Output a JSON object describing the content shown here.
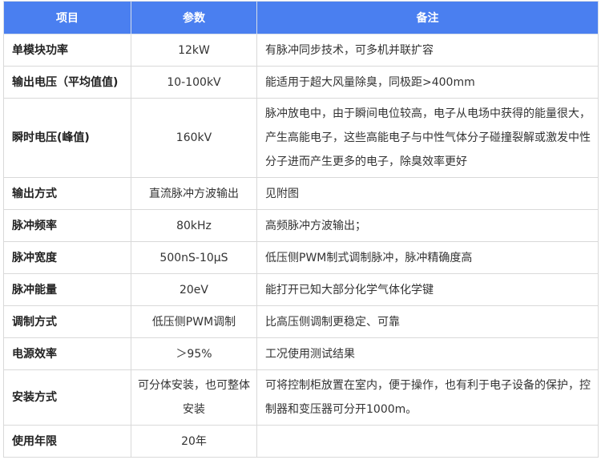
{
  "header": {
    "col1": "项目",
    "col2": "参数",
    "col3": "备注"
  },
  "rows": [
    {
      "item": "单模块功率",
      "param": "12kW",
      "note": "有脉冲同步技术，可多机并联扩容"
    },
    {
      "item": "输出电压（平均值值)",
      "param": "10-100kV",
      "note": "能适用于超大风量除臭，同极距>400mm"
    },
    {
      "item": "瞬时电压(峰值)",
      "param": "160kV",
      "note": "脉冲放电中，由于瞬间电位较高，电子从电场中获得的能量很大，产生高能电子，这些高能电子与中性气体分子碰撞裂解或激发中性分子进而产生更多的电子，除臭效率更好"
    },
    {
      "item": "输出方式",
      "param": "直流脉冲方波输出",
      "note": "见附图"
    },
    {
      "item": "脉冲频率",
      "param": "80kHz",
      "note": "高频脉冲方波输出；"
    },
    {
      "item": "脉冲宽度",
      "param": "500nS-10μS",
      "note": "低压侧PWM制式调制脉冲，脉冲精确度高"
    },
    {
      "item": "脉冲能量",
      "param": "20eV",
      "note": "能打开已知大部分化学气体化学键"
    },
    {
      "item": "调制方式",
      "param": "低压侧PWM调制",
      "note": "比高压侧调制更稳定、可靠"
    },
    {
      "item": "电源效率",
      "param": "＞95%",
      "note": "工况使用测试结果"
    },
    {
      "item": "安装方式",
      "param": "可分体安装，也可整体安装",
      "note": "可将控制柜放置在室内，便于操作，也有利于电子设备的保护，控制器和变压器可分开1000m。"
    },
    {
      "item": "使用年限",
      "param": "20年",
      "note": ""
    }
  ]
}
